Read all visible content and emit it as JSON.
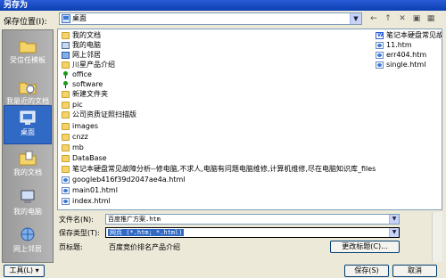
{
  "window": {
    "title": "另存为"
  },
  "save_in": {
    "label": "保存位置(I):",
    "value": "桌面"
  },
  "toolbar": {
    "back": "←",
    "up": "↑",
    "delete": "✕",
    "new_folder": "▣",
    "views": "▦"
  },
  "places": [
    {
      "label": "受信任模板",
      "icon": "folder-icon"
    },
    {
      "label": "我最近的文档",
      "icon": "recent-docs-icon"
    },
    {
      "label": "桌面",
      "icon": "desktop-icon",
      "selected": true
    },
    {
      "label": "我的文档",
      "icon": "documents-icon"
    },
    {
      "label": "我的电脑",
      "icon": "computer-icon"
    },
    {
      "label": "网上邻居",
      "icon": "network-icon"
    }
  ],
  "files_col1": [
    {
      "name": "我的文档",
      "type": "folder"
    },
    {
      "name": "我的电脑",
      "type": "computer"
    },
    {
      "name": "网上邻居",
      "type": "network"
    },
    {
      "name": "川星产品介绍",
      "type": "folder"
    },
    {
      "name": "office",
      "type": "pin"
    },
    {
      "name": "software",
      "type": "pin"
    },
    {
      "name": "新建文件夹",
      "type": "folder"
    },
    {
      "name": "pic",
      "type": "folder"
    },
    {
      "name": "公司资质证照扫描版",
      "type": "folder"
    },
    {
      "name": "images",
      "type": "folder"
    },
    {
      "name": "cnzz",
      "type": "folder"
    },
    {
      "name": "mb",
      "type": "folder"
    },
    {
      "name": "DataBase",
      "type": "folder"
    },
    {
      "name": "笔记本硬盘常见故障分析--修电脑,不求人,电脑有问题电脑维修,计算机维修,尽在电脑知识库_files",
      "type": "folder"
    },
    {
      "name": "googleb416f39d2047ae4a.html",
      "type": "doc"
    },
    {
      "name": "main01.html",
      "type": "doc"
    },
    {
      "name": "index.html",
      "type": "doc"
    }
  ],
  "files_col2": [
    {
      "name": "笔记本硬盘常见故障",
      "type": "word"
    },
    {
      "name": "11.htm",
      "type": "doc"
    },
    {
      "name": "err404.htm",
      "type": "doc"
    },
    {
      "name": "single.html",
      "type": "doc"
    }
  ],
  "form": {
    "filename_label": "文件名(N):",
    "filename_value": "百度推广方案.htm",
    "filetype_label": "保存类型(T):",
    "filetype_value": "网页 (*.htm; *.html)",
    "pagetitle_label": "页标题:",
    "pagetitle_value": "百度竞价排名产品介绍",
    "change_title_button": "更改标题(C)..."
  },
  "buttons": {
    "tools": "工具(L)",
    "save": "保存(S)",
    "cancel": "取消"
  }
}
